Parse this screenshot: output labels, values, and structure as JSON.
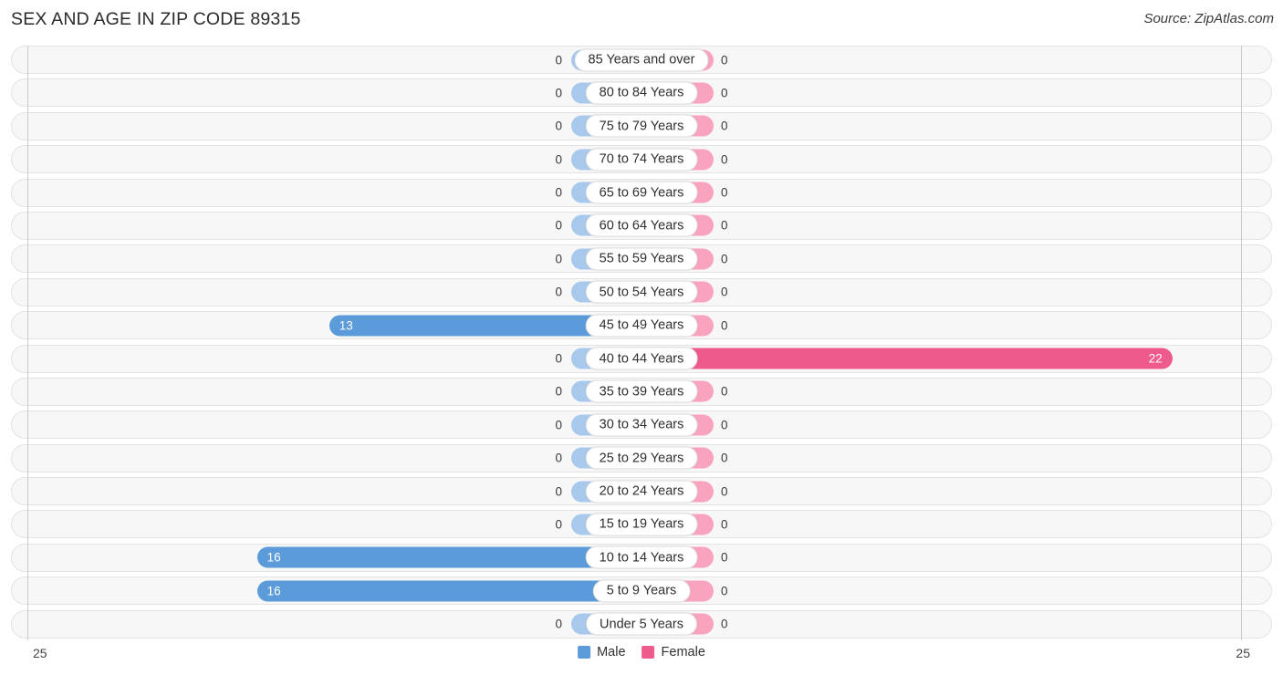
{
  "header": {
    "title": "SEX AND AGE IN ZIP CODE 89315",
    "source": "Source: ZipAtlas.com"
  },
  "legend": {
    "male_label": "Male",
    "female_label": "Female",
    "male_color": "#5b9bd9",
    "female_color": "#ef5a8c"
  },
  "axis": {
    "left_tick": "25",
    "right_tick": "25",
    "max": 25
  },
  "colors": {
    "male_strong": "#5b9bd9",
    "male_light": "#a8c8ec",
    "female_strong": "#ef5a8c",
    "female_light": "#f9a3bf",
    "row_bg": "#f7f7f7",
    "row_border": "#e3e3e3"
  },
  "chart_data": {
    "type": "bar",
    "title": "SEX AND AGE IN ZIP CODE 89315",
    "subtitle": "Source: ZipAtlas.com",
    "orientation": "horizontal",
    "layout": "population-pyramid",
    "xlabel": "",
    "ylabel": "",
    "xlim": [
      -25,
      25
    ],
    "axis_tick_labels": [
      "25",
      "25"
    ],
    "grid": false,
    "legend_position": "bottom-center",
    "categories": [
      "85 Years and over",
      "80 to 84 Years",
      "75 to 79 Years",
      "70 to 74 Years",
      "65 to 69 Years",
      "60 to 64 Years",
      "55 to 59 Years",
      "50 to 54 Years",
      "45 to 49 Years",
      "40 to 44 Years",
      "35 to 39 Years",
      "30 to 34 Years",
      "25 to 29 Years",
      "20 to 24 Years",
      "15 to 19 Years",
      "10 to 14 Years",
      "5 to 9 Years",
      "Under 5 Years"
    ],
    "series": [
      {
        "name": "Male",
        "color": "#5b9bd9",
        "values": [
          0,
          0,
          0,
          0,
          0,
          0,
          0,
          0,
          13,
          0,
          0,
          0,
          0,
          0,
          0,
          16,
          16,
          0
        ]
      },
      {
        "name": "Female",
        "color": "#ef5a8c",
        "values": [
          0,
          0,
          0,
          0,
          0,
          0,
          0,
          0,
          0,
          22,
          0,
          0,
          0,
          0,
          0,
          0,
          0,
          0
        ]
      }
    ]
  },
  "rows": [
    {
      "age": "85 Years and over",
      "male": 0,
      "female": 0,
      "male_text": "0",
      "female_text": "0"
    },
    {
      "age": "80 to 84 Years",
      "male": 0,
      "female": 0,
      "male_text": "0",
      "female_text": "0"
    },
    {
      "age": "75 to 79 Years",
      "male": 0,
      "female": 0,
      "male_text": "0",
      "female_text": "0"
    },
    {
      "age": "70 to 74 Years",
      "male": 0,
      "female": 0,
      "male_text": "0",
      "female_text": "0"
    },
    {
      "age": "65 to 69 Years",
      "male": 0,
      "female": 0,
      "male_text": "0",
      "female_text": "0"
    },
    {
      "age": "60 to 64 Years",
      "male": 0,
      "female": 0,
      "male_text": "0",
      "female_text": "0"
    },
    {
      "age": "55 to 59 Years",
      "male": 0,
      "female": 0,
      "male_text": "0",
      "female_text": "0"
    },
    {
      "age": "50 to 54 Years",
      "male": 0,
      "female": 0,
      "male_text": "0",
      "female_text": "0"
    },
    {
      "age": "45 to 49 Years",
      "male": 13,
      "female": 0,
      "male_text": "13",
      "female_text": "0"
    },
    {
      "age": "40 to 44 Years",
      "male": 0,
      "female": 22,
      "male_text": "0",
      "female_text": "22"
    },
    {
      "age": "35 to 39 Years",
      "male": 0,
      "female": 0,
      "male_text": "0",
      "female_text": "0"
    },
    {
      "age": "30 to 34 Years",
      "male": 0,
      "female": 0,
      "male_text": "0",
      "female_text": "0"
    },
    {
      "age": "25 to 29 Years",
      "male": 0,
      "female": 0,
      "male_text": "0",
      "female_text": "0"
    },
    {
      "age": "20 to 24 Years",
      "male": 0,
      "female": 0,
      "male_text": "0",
      "female_text": "0"
    },
    {
      "age": "15 to 19 Years",
      "male": 0,
      "female": 0,
      "male_text": "0",
      "female_text": "0"
    },
    {
      "age": "10 to 14 Years",
      "male": 16,
      "female": 0,
      "male_text": "16",
      "female_text": "0"
    },
    {
      "age": "5 to 9 Years",
      "male": 16,
      "female": 0,
      "male_text": "16",
      "female_text": "0"
    },
    {
      "age": "Under 5 Years",
      "male": 0,
      "female": 0,
      "male_text": "0",
      "female_text": "0"
    }
  ]
}
